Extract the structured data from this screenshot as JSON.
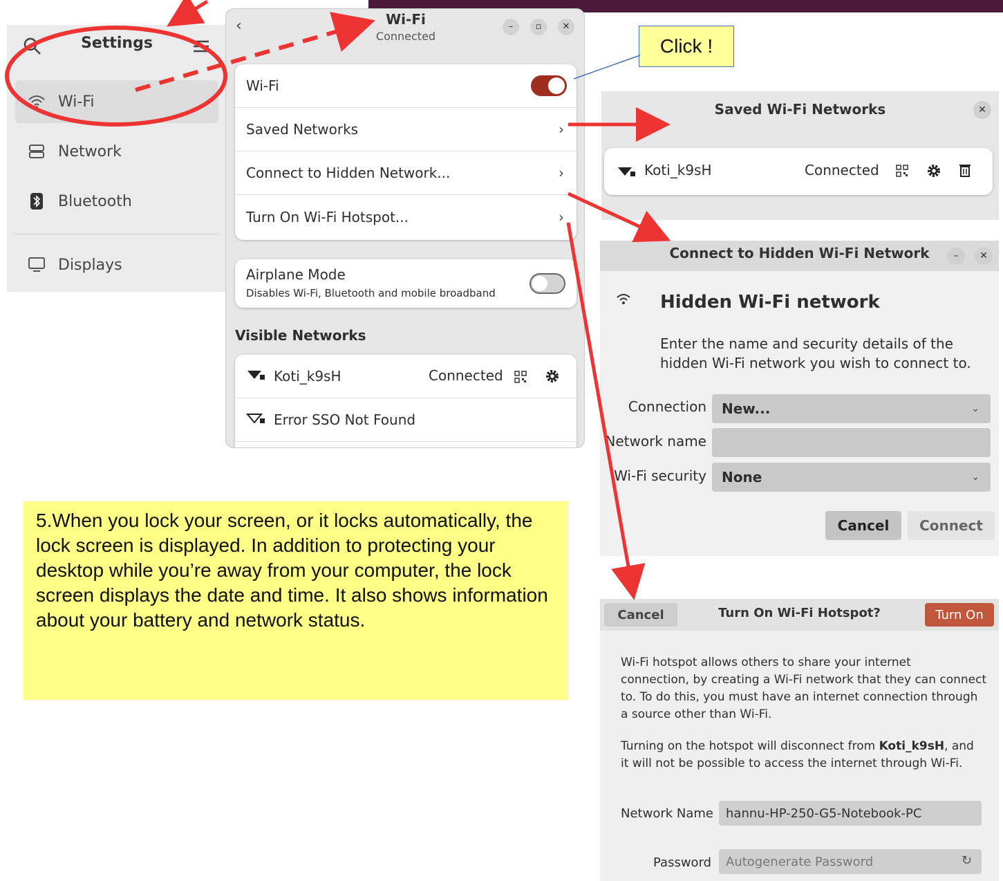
{
  "settings": {
    "title": "Settings",
    "items": [
      {
        "label": "Wi-Fi",
        "icon": "wifi-icon",
        "active": true
      },
      {
        "label": "Network",
        "icon": "network-icon"
      },
      {
        "label": "Bluetooth",
        "icon": "bluetooth-icon"
      },
      {
        "label": "Displays",
        "icon": "display-icon"
      }
    ]
  },
  "wifi_window": {
    "back": "‹",
    "title": "Wi-Fi",
    "subtitle": "Connected",
    "rows": [
      "Wi-Fi",
      "Saved Networks",
      "Connect to Hidden Network...",
      "Turn On Wi-Fi Hotspot..."
    ],
    "airplane_title": "Airplane Mode",
    "airplane_desc": "Disables Wi-Fi, Bluetooth and mobile broadband",
    "visible_heading": "Visible Networks",
    "networks": [
      {
        "name": "Koti_k9sH",
        "status": "Connected"
      },
      {
        "name": "Error SSO Not Found",
        "status": ""
      }
    ],
    "wifi_on": true,
    "airplane_on": false
  },
  "callout": "Click !",
  "saved_dialog": {
    "title": "Saved Wi-Fi Networks",
    "network": "Koti_k9sH",
    "status": "Connected"
  },
  "hidden_dialog": {
    "title": "Connect to Hidden Wi-Fi Network",
    "heading": "Hidden Wi-Fi network",
    "desc_line1": "Enter the name and security details of the",
    "desc_line2": "hidden Wi-Fi network you wish to connect to.",
    "connection_label": "Connection",
    "connection_value": "New...",
    "name_label": "Network name",
    "security_label": "Wi-Fi security",
    "security_value": "None",
    "cancel": "Cancel",
    "connect": "Connect"
  },
  "note": "5.When you lock your screen, or it locks automatically, the lock screen is displayed. In addition to protecting your desktop while you’re away from your computer, the lock screen displays the date and time. It also shows information about your battery and network status.",
  "hotspot_dialog": {
    "cancel": "Cancel",
    "title": "Turn On Wi-Fi Hotspot?",
    "turn_on": "Turn On",
    "para1_l1": "Wi-Fi hotspot allows others to share your internet",
    "para1_l2": "connection, by creating a Wi-Fi network that they can connect",
    "para1_l3": "to. To do this, you must have an internet connection through",
    "para1_l4": "a source other than Wi-Fi.",
    "para2_pre": "Turning on the hotspot will disconnect from ",
    "para2_bold": "Koti_k9sH",
    "para2_post": ", and",
    "para2_l2": "it will not be possible to access the internet through Wi-Fi.",
    "name_label": "Network Name",
    "name_value": "hannu-HP-250-G5-Notebook-PC",
    "password_label": "Password",
    "password_placeholder": "Autogenerate Password"
  },
  "colors": {
    "accent": "#9e2f1f",
    "arrow": "#ee3333",
    "note_bg": "#ffff88",
    "turn_on_bg": "#c0573a"
  }
}
